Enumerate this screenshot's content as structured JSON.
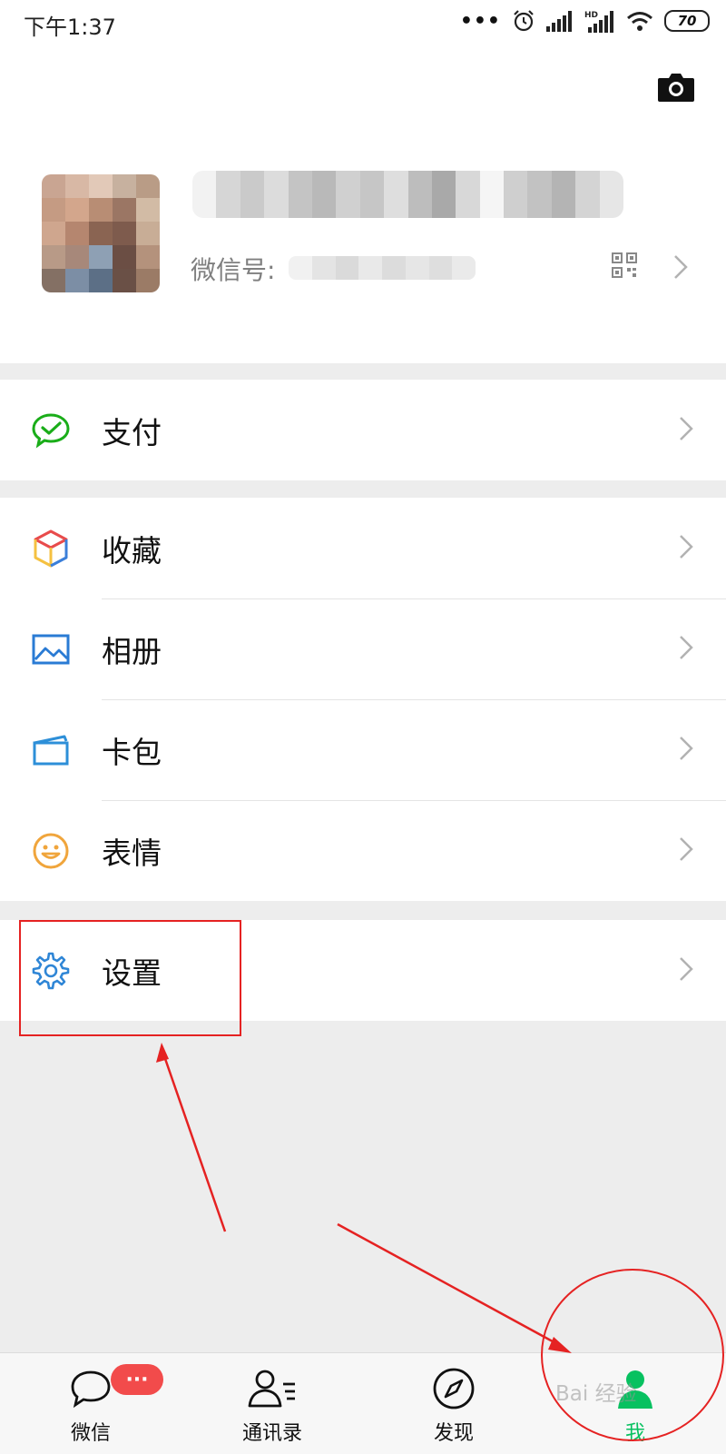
{
  "status_bar": {
    "time": "下午1:37",
    "battery": "70"
  },
  "profile": {
    "wechat_id_label": "微信号:"
  },
  "menu": {
    "pay": "支付",
    "favorites": "收藏",
    "album": "相册",
    "cards": "卡包",
    "stickers": "表情",
    "settings": "设置"
  },
  "tabbar": {
    "chats": "微信",
    "contacts": "通讯录",
    "discover": "发现",
    "me": "我",
    "chats_badge": "···"
  },
  "watermark": "Bai 经验",
  "colors": {
    "accent": "#07c160",
    "annotation": "#e52222",
    "badge": "#f24b4b"
  }
}
